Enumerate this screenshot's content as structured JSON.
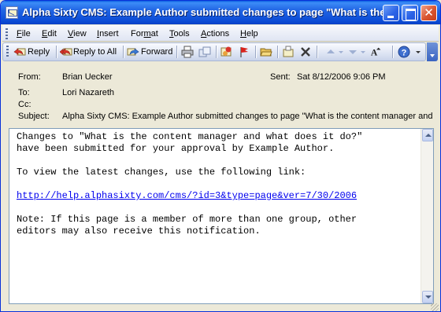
{
  "window": {
    "title": "Alpha Sixty CMS: Example Author submitted changes to page \"What is the ...",
    "close_glyph": "✕"
  },
  "menu": {
    "items": [
      {
        "underline": "F",
        "rest": "ile"
      },
      {
        "underline": "E",
        "rest": "dit"
      },
      {
        "underline": "V",
        "rest": "iew"
      },
      {
        "underline": "I",
        "rest": "nsert"
      },
      {
        "underline": "",
        "rest": "Format",
        "underline_index": 3
      },
      {
        "underline": "T",
        "rest": "ools"
      },
      {
        "underline": "A",
        "rest": "ctions"
      },
      {
        "underline": "H",
        "rest": "elp"
      }
    ]
  },
  "toolbar": {
    "reply_label": "Reply",
    "reply_all_label": "Reply to All",
    "forward_label": "Forward"
  },
  "header": {
    "from_label": "From:",
    "from_value": "Brian Uecker",
    "sent_label": "Sent:",
    "sent_value": "Sat 8/12/2006 9:06 PM",
    "to_label": "To:",
    "to_value": "Lori Nazareth",
    "cc_label": "Cc:",
    "cc_value": "",
    "subject_label": "Subject:",
    "subject_value": "Alpha Sixty CMS: Example Author submitted changes to page \"What is the content manager and what does it do?\""
  },
  "body": {
    "line1": "Changes to \"What is the content manager and what does it do?\"",
    "line2": "have been submitted for your approval by Example Author.",
    "line3": "To view the latest changes, use the following link:",
    "link": "http://help.alphasixty.com/cms/?id=3&type=page&ver=7/30/2006",
    "line4": "Note: If this page is a member of more than one group, other",
    "line5": "editors may also receive this notification."
  }
}
